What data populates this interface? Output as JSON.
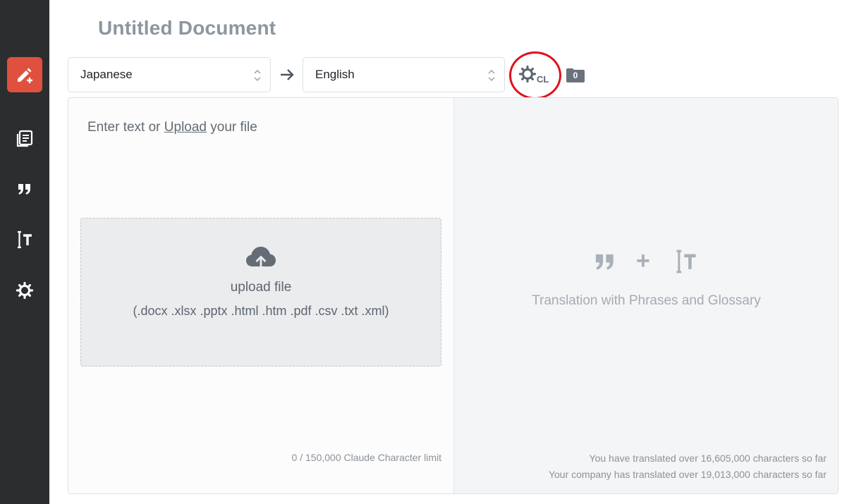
{
  "document": {
    "title": "Untitled Document"
  },
  "sidebar": {
    "items": [
      {
        "name": "new-translation",
        "icon": "edit-plus-icon",
        "active": true
      },
      {
        "name": "documents",
        "icon": "documents-icon"
      },
      {
        "name": "phrases",
        "icon": "quote-icon"
      },
      {
        "name": "glossary",
        "icon": "text-cursor-icon"
      },
      {
        "name": "settings",
        "icon": "gear-icon"
      }
    ]
  },
  "toolbar": {
    "source_language": "Japanese",
    "target_language": "English",
    "cl_label": "CL",
    "folder_count": "0"
  },
  "editor": {
    "placeholder_prefix": "Enter text or ",
    "placeholder_link": "Upload",
    "placeholder_suffix": " your file",
    "upload_label": "upload file",
    "upload_types": "(.docx .xlsx .pptx .html .htm .pdf .csv .txt .xml)",
    "char_limit": "0 / 150,000 Claude Character limit"
  },
  "output": {
    "hint_plus": "+",
    "hint_text": "Translation with Phrases and Glossary",
    "stats_user": "You have translated over 16,605,000 characters so far",
    "stats_company": "Your company has translated over 19,013,000 characters so far"
  },
  "colors": {
    "accent": "#e0503f",
    "sidebar": "#2c2d2f",
    "highlight": "#e0111b"
  }
}
